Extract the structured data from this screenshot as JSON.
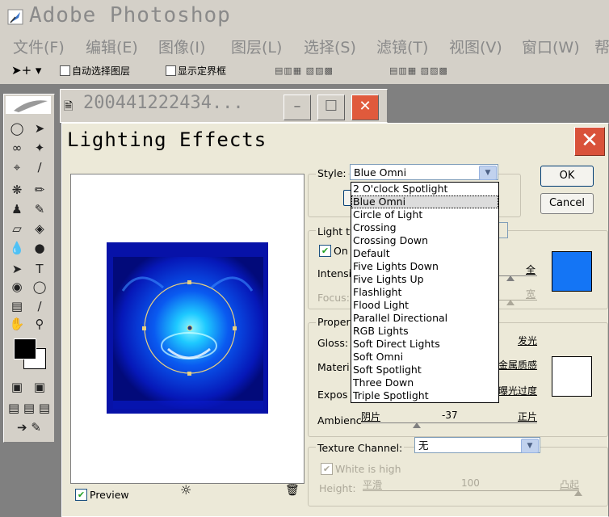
{
  "app": {
    "title": "Adobe Photoshop",
    "icon": "feather-icon"
  },
  "menu": [
    "文件(F)",
    "编辑(E)",
    "图像(I)",
    "图层(L)",
    "选择(S)",
    "滤镜(T)",
    "视图(V)",
    "窗口(W)",
    "帮"
  ],
  "options_bar": {
    "auto_select": "自动选择图层",
    "show_bounds": "显示定界框"
  },
  "document": {
    "title": "200441222434..."
  },
  "dialog": {
    "title": "Lighting Effects",
    "preview_label": "Preview",
    "style": {
      "label": "Style:",
      "value": "Blue Omni"
    },
    "ok": "OK",
    "cancel": "Cancel",
    "light_type": {
      "label": "Light ty",
      "on_label": "On",
      "intensity_label": "Intensit",
      "intensity_right": "全",
      "focus_label": "Focus:",
      "focus_right": "宽",
      "color": "#1475f5"
    },
    "properties": {
      "label": "Proper",
      "gloss_label": "Gloss:",
      "gloss_right": "发光",
      "material_label": "Materi",
      "material_right": "金属质感",
      "exposure_label": "Expos",
      "exposure_right": "曝光过度",
      "ambience_label": "Ambienc",
      "ambience_left": "阴片",
      "ambience_value": "-37",
      "ambience_right": "正片",
      "color": "#ffffff"
    },
    "texture": {
      "label": "Texture Channel:",
      "value": "无",
      "white_high": "White is high",
      "height_label": "Height:",
      "height_left": "平滑",
      "height_value": "100",
      "height_right": "凸起"
    }
  },
  "style_options": [
    "2 O'clock Spotlight",
    "Blue Omni",
    "Circle of Light",
    "Crossing",
    "Crossing Down",
    "Default",
    "Five Lights Down",
    "Five Lights Up",
    "Flashlight",
    "Flood Light",
    "Parallel Directional",
    "RGB Lights",
    "Soft Direct Lights",
    "Soft Omni",
    "Soft Spotlight",
    "Three Down",
    "Triple Spotlight"
  ],
  "selected_style_index": 1,
  "colors": {
    "close_red": "#d9523a",
    "selected_row": "#dcdcdc"
  }
}
